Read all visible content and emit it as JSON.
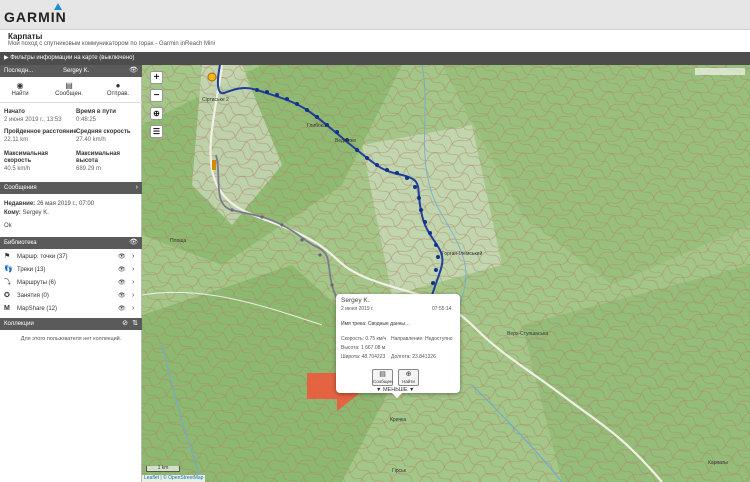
{
  "header": {
    "logo": "GARMIN"
  },
  "page": {
    "title": "Карпаты",
    "subtitle": "Мой поход с спутниковым коммуникатором по горах - Garmin inReach Mini"
  },
  "filter_bar": {
    "label": "▶ Фильтры информации на карте (выключено)"
  },
  "last_position": {
    "header_label": "Последн...",
    "user": "Sergey K.",
    "actions": [
      {
        "label": "Найти",
        "icon": "target-icon"
      },
      {
        "label": "Сообщен.",
        "icon": "message-icon"
      },
      {
        "label": "Отправ.",
        "icon": "pin-icon"
      }
    ],
    "stats": {
      "start_label": "Начато",
      "start_value": "2 июня 2019 г., 13:53",
      "moving_time_label": "Время в пути",
      "moving_time_value": "0:48:25",
      "distance_label": "Пройденное расстояние",
      "distance_value": "22.11 km",
      "avg_speed_label": "Средняя скорость",
      "avg_speed_value": "27.40 km/h",
      "max_speed_label_1": "Максимальная",
      "max_speed_label_2": "скорость",
      "max_speed_value": "40.5 km/h",
      "max_alt_label_1": "Максимальная",
      "max_alt_label_2": "высота",
      "max_alt_value": "689.29 m"
    }
  },
  "messages": {
    "header_label": "Сообщения",
    "recent_label": "Недавние:",
    "recent_value": "26 мая 2019 г., 07:00",
    "to_label": "Кому:",
    "to_value": "Sergey K.",
    "body": "Ok"
  },
  "library": {
    "header_label": "Библиотека",
    "items": [
      {
        "label": "Маршр. точки (37)",
        "icon": "flag-icon"
      },
      {
        "label": "Треки (13)",
        "icon": "footprints-icon"
      },
      {
        "label": "Маршруты (6)",
        "icon": "route-icon"
      },
      {
        "label": "Занятия (0)",
        "icon": "activity-icon"
      },
      {
        "label": "MapShare (12)",
        "icon": "mapshare-icon"
      }
    ]
  },
  "collections": {
    "header_label": "Коллекции",
    "empty_text": "Для этого пользователя нет коллекций."
  },
  "map": {
    "zoom_in": "+",
    "zoom_out": "−",
    "scale_label": "1 km",
    "attribution": "Leaflet | © OpenStreetMap",
    "labels": {
      "a": "Сіртиське 2",
      "b": "Площа",
      "c": "Горган-Ілемський",
      "d": "Верх-Ступшаська",
      "e": "Карпаты",
      "f": "Кричка",
      "g": "Глибока",
      "h": "Гірськ",
      "i": "Ведмеже"
    }
  },
  "popup": {
    "name": "Sergey K.",
    "date": "2 июня 2019 г.",
    "time": "07:55:14",
    "track_name": "Имя трека: Сводные данны…",
    "speed": "Скорость: 0.75 км/ч",
    "direction": "Направление: Недоступно",
    "altitude": "Высота: 1 667.08 м",
    "latitude": "Широта: 48.704223",
    "longitude": "Долгота: 23.841326",
    "msg_button": "Сообщен.",
    "find_button": "Найти",
    "less_label": "▼ МЕНЬШЕ ▼"
  }
}
